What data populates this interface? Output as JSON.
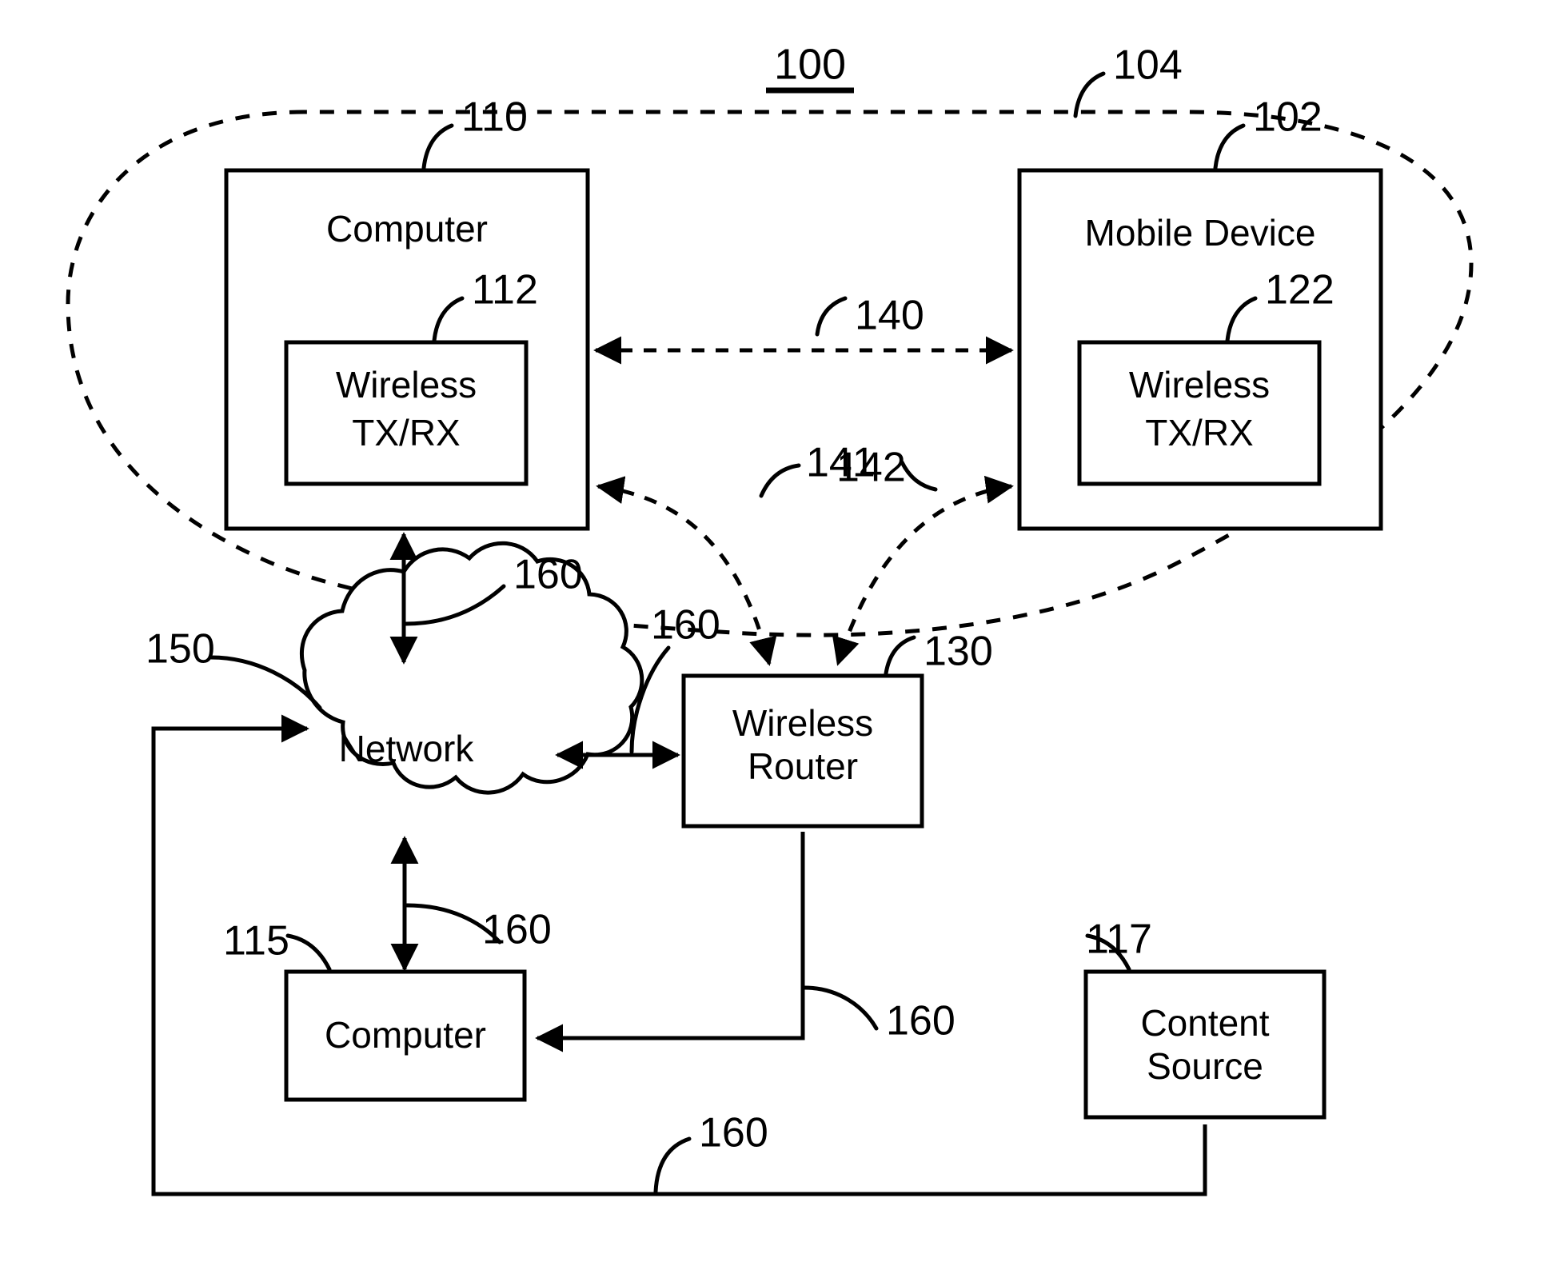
{
  "figure": {
    "number": "100",
    "underlined": true
  },
  "reference_numerals": {
    "system_boundary": "104",
    "computer_110": "110",
    "computer_110_txrx": "112",
    "mobile_device": "102",
    "mobile_device_txrx": "122",
    "link_direct": "140",
    "link_router_to_computer": "141",
    "link_router_to_mobile": "142",
    "wireless_router": "130",
    "network": "150",
    "computer_115": "115",
    "content_source": "117",
    "wired_link_a": "160",
    "wired_link_b": "160",
    "wired_link_c": "160",
    "wired_link_d": "160",
    "wired_link_e": "160"
  },
  "nodes": {
    "computer_top": {
      "label": "Computer",
      "ref": "110"
    },
    "computer_top_txrx": {
      "line1": "Wireless",
      "line2": "TX/RX",
      "ref": "112"
    },
    "mobile_device": {
      "label": "Mobile Device",
      "ref": "102"
    },
    "mobile_device_txrx": {
      "line1": "Wireless",
      "line2": "TX/RX",
      "ref": "122"
    },
    "wireless_router": {
      "line1": "Wireless",
      "line2": "Router",
      "ref": "130"
    },
    "network": {
      "label": "Network",
      "ref": "150"
    },
    "computer_bottom": {
      "label": "Computer",
      "ref": "115"
    },
    "content_source": {
      "line1": "Content",
      "line2": "Source",
      "ref": "117"
    }
  },
  "connections": {
    "c140": {
      "ref": "140",
      "style": "dashed",
      "from": "Computer 110",
      "to": "Mobile Device 102",
      "arrows": "both"
    },
    "c141": {
      "ref": "141",
      "style": "dashed",
      "from": "Wireless Router 130",
      "to": "Computer 110",
      "arrows": "both"
    },
    "c142": {
      "ref": "142",
      "style": "dashed",
      "from": "Wireless Router 130",
      "to": "Mobile Device 102",
      "arrows": "both"
    },
    "c160_computer_network": {
      "ref": "160",
      "style": "solid",
      "from": "Computer 110",
      "to": "Network 150",
      "arrows": "both"
    },
    "c160_network_router": {
      "ref": "160",
      "style": "solid",
      "from": "Network 150",
      "to": "Wireless Router 130",
      "arrows": "both"
    },
    "c160_network_computer115": {
      "ref": "160",
      "style": "solid",
      "from": "Network 150",
      "to": "Computer 115",
      "arrows": "both"
    },
    "c160_router_computer115": {
      "ref": "160",
      "style": "solid",
      "from": "Wireless Router 130",
      "to": "Computer 115",
      "arrows": "single"
    },
    "c160_contentsource_network": {
      "ref": "160",
      "style": "solid",
      "from": "Content Source 117",
      "to": "Network 150",
      "arrows": "single"
    }
  },
  "colors": {
    "stroke": "#000000",
    "fill": "#ffffff",
    "text": "#000000"
  }
}
